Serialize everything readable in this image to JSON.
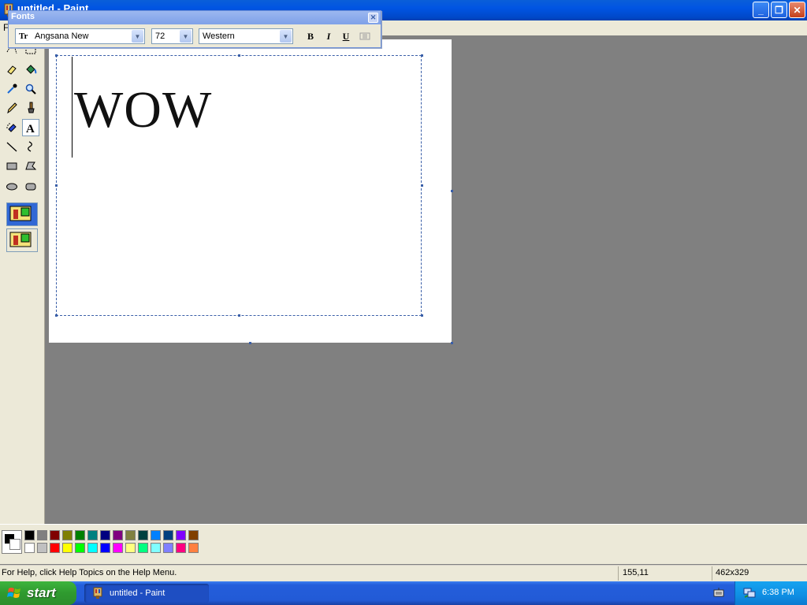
{
  "window": {
    "title": "untitled - Paint",
    "menu_first": "F"
  },
  "fonts_toolbar": {
    "title": "Fonts",
    "font_name": "Angsana New",
    "font_size": "72",
    "script": "Western",
    "bold_label": "B",
    "italic_label": "I",
    "underline_label": "U",
    "font_type_glyph": "Tr"
  },
  "canvas": {
    "text": "WOW"
  },
  "palette": {
    "foreground": "#000000",
    "background": "#ffffff",
    "row1": [
      "#000000",
      "#808080",
      "#800000",
      "#808000",
      "#008000",
      "#008080",
      "#000080",
      "#800080",
      "#808040",
      "#004040",
      "#0080ff",
      "#004080",
      "#8000ff",
      "#804000"
    ],
    "row2": [
      "#ffffff",
      "#c0c0c0",
      "#ff0000",
      "#ffff00",
      "#00ff00",
      "#00ffff",
      "#0000ff",
      "#ff00ff",
      "#ffff80",
      "#00ff80",
      "#80ffff",
      "#8080ff",
      "#ff0080",
      "#ff8040"
    ]
  },
  "statusbar": {
    "help_text": "For Help, click Help Topics on the Help Menu.",
    "cursor_pos": "155,11",
    "image_size": "462x329"
  },
  "taskbar": {
    "start_label": "start",
    "task_label": "untitled - Paint",
    "clock": "6:38 PM"
  },
  "icons": [
    "paint-app-icon",
    "minimize-icon",
    "maximize-icon",
    "close-icon",
    "free-select-icon",
    "select-icon",
    "eraser-icon",
    "fill-icon",
    "picker-icon",
    "magnifier-icon",
    "pencil-icon",
    "brush-icon",
    "airbrush-icon",
    "text-icon",
    "line-icon",
    "curve-icon",
    "rectangle-icon",
    "polygon-icon",
    "ellipse-icon",
    "rounded-rect-icon",
    "windows-flag-icon",
    "keyboard-icon",
    "network-icon"
  ]
}
